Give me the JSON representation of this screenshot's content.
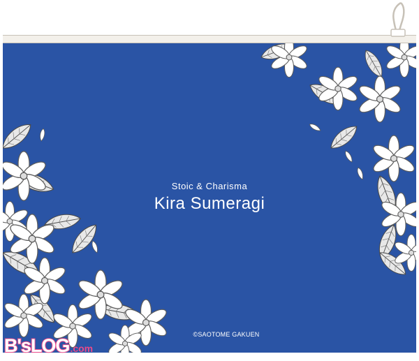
{
  "product": {
    "subtitle": "Stoic & Charisma",
    "name": "Kira Sumeragi",
    "copyright": "©SAOTOME GAKUEN"
  },
  "watermark": {
    "main": "B'sLOG",
    "tld": ".com",
    "color": "#e84a8a"
  },
  "colors": {
    "pouch": "#2a54a5",
    "flowers": "#ffffff",
    "zipper": "#c7c1b7"
  },
  "icons": [
    "zipper-pull-icon",
    "jasmine-flower-illustration"
  ]
}
